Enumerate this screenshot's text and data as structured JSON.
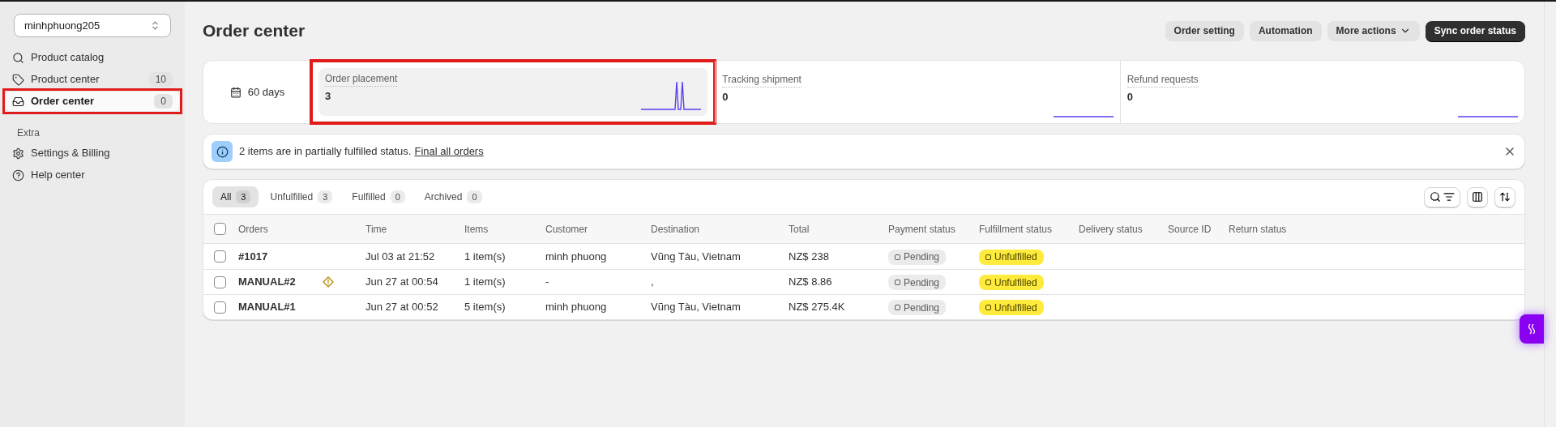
{
  "store_selector": {
    "value": "minhphuong205"
  },
  "sidebar": {
    "items": [
      {
        "label": "Product catalog",
        "selected": false,
        "highlighted": false
      },
      {
        "label": "Product center",
        "count": "10",
        "selected": false,
        "highlighted": false
      },
      {
        "label": "Order center",
        "count": "0",
        "selected": true,
        "highlighted": true
      }
    ],
    "section_title": "Extra",
    "extra_items": [
      {
        "label": "Settings & Billing",
        "selected": false
      },
      {
        "label": "Help center",
        "selected": false
      }
    ]
  },
  "page_title": "Order center",
  "header_buttons": [
    {
      "label": "Order setting",
      "kind": "plain"
    },
    {
      "label": "Automation",
      "kind": "plain"
    },
    {
      "label": "More actions",
      "kind": "menu"
    },
    {
      "label": "Sync order status",
      "kind": "primary"
    }
  ],
  "period": {
    "label": "60 days"
  },
  "metrics": [
    {
      "label": "Order placement",
      "value": "3",
      "selected": true,
      "highlighted": true
    },
    {
      "label": "Tracking shipment",
      "value": "0",
      "selected": false,
      "highlighted": false
    },
    {
      "label": "Refund requests",
      "value": "0",
      "selected": false,
      "highlighted": false
    }
  ],
  "banner": {
    "text": "2 items are in partially fulfilled status.",
    "link": "Final all orders"
  },
  "tabs": [
    {
      "label": "All",
      "count": "3",
      "selected": true
    },
    {
      "label": "Unfulfilled",
      "count": "3",
      "selected": false
    },
    {
      "label": "Fulfilled",
      "count": "0",
      "selected": false
    },
    {
      "label": "Archived",
      "count": "0",
      "selected": false
    }
  ],
  "table": {
    "all_checked": false,
    "columns": [
      "Orders",
      "Time",
      "Items",
      "Customer",
      "Destination",
      "Total",
      "Payment status",
      "Fulfillment status",
      "Delivery status",
      "Source ID",
      "Return status"
    ],
    "rows": [
      {
        "order": "#1017",
        "warning": false,
        "time": "Jul 03 at 21:52",
        "items": "1 item(s)",
        "customer": "minh phuong",
        "destination": "Vũng Tàu, Vietnam",
        "total": "NZ$ 238",
        "payment_status": "Pending",
        "fulfillment_status": "Unfulfilled",
        "checked": false
      },
      {
        "order": "MANUAL#2",
        "warning": true,
        "time": "Jun 27 at 00:54",
        "items": "1 item(s)",
        "customer": "-",
        "destination": ",",
        "total": "NZ$ 8.86",
        "payment_status": "Pending",
        "fulfillment_status": "Unfulfilled",
        "checked": false
      },
      {
        "order": "MANUAL#1",
        "warning": false,
        "time": "Jun 27 at 00:52",
        "items": "5 item(s)",
        "customer": "minh phuong",
        "destination": "Vũng Tàu, Vietnam",
        "total": "NZ$ 275.4K",
        "payment_status": "Pending",
        "fulfillment_status": "Unfulfilled",
        "checked": false
      }
    ]
  }
}
